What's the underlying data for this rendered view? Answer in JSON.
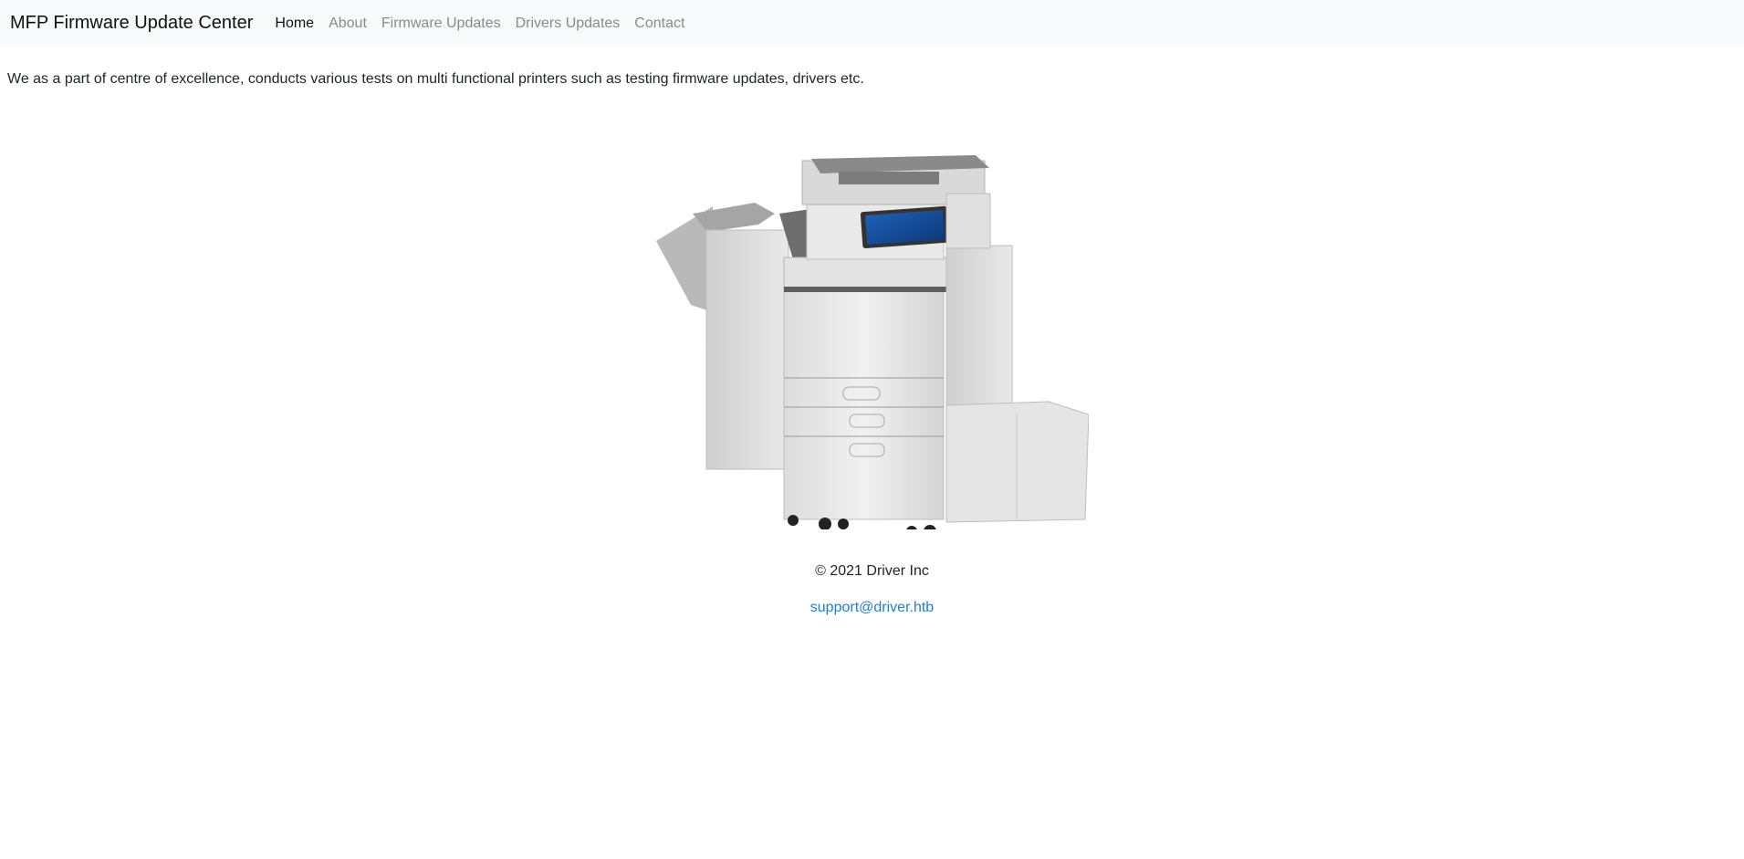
{
  "nav": {
    "brand": "MFP Firmware Update Center",
    "links": [
      {
        "label": "Home",
        "active": true
      },
      {
        "label": "About",
        "active": false
      },
      {
        "label": "Firmware Updates",
        "active": false
      },
      {
        "label": "Drivers Updates",
        "active": false
      },
      {
        "label": "Contact",
        "active": false
      }
    ]
  },
  "main": {
    "intro": "We as a part of centre of excellence, conducts various tests on multi functional printers such as testing firmware updates, drivers etc."
  },
  "footer": {
    "copyright": "© 2021 Driver Inc",
    "email": "support@driver.htb"
  },
  "colors": {
    "navbar_bg": "#f8f9fa",
    "link_muted": "#8a8a8a",
    "link_active": "#111111",
    "email_link": "#1a7fd6"
  },
  "icons": [
    "printer-image"
  ]
}
